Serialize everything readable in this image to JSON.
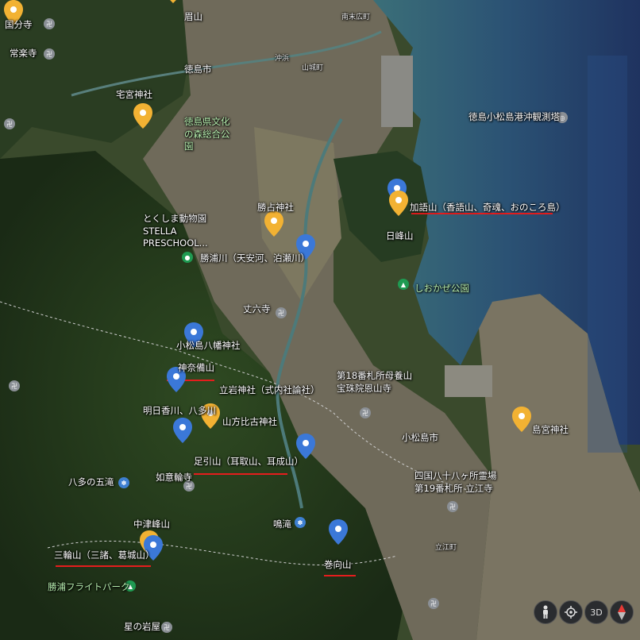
{
  "map_type": "satellite map view",
  "colors": {
    "pin_yellow": "#f2b233",
    "pin_blue": "#3b78d8",
    "underline_red": "#e51d1d",
    "sea": "#2f4f6a",
    "deep_sea": "#22375a"
  },
  "labels": {
    "l01": "眉山",
    "l02": "徳島市",
    "l03": "宅宮神社",
    "l04": "徳島県文化の森総合公園",
    "l05": "勝占神社",
    "l06": "とくしま動物園 STELLA PRESCHOOL...",
    "l07": "勝浦川（天安河、泊瀬川）",
    "l08": "加語山（香語山、奇魂、おのころ島）",
    "l09": "日峰山",
    "l10": "しおかぜ公園",
    "l11": "徳島小松島港沖観測塔",
    "l12": "丈六寺",
    "l13": "小松島八幡神社",
    "l14": "神奈備山",
    "l15": "立岩神社（式内社論社）",
    "l16": "明日香川、八多川",
    "l17": "山方比古神社",
    "l18": "足引山（耳取山、耳成山）",
    "l19": "如意輪寺",
    "l20": "八多の五滝",
    "l21": "中津峰山",
    "l22": "鳴滝",
    "l23": "三輪山（三諸、葛城山）",
    "l24": "巻向山",
    "l25": "勝浦フライトパーク",
    "l26": "星の岩屋",
    "l27": "第18番札所母養山宝珠院恩山寺",
    "l28": "小松島市",
    "l29": "四国八十八ヶ所霊場第19番札所 立江寺",
    "l30": "立江町",
    "l31": "島宮神社",
    "l32": "常楽寺",
    "l33": "国分寺",
    "l34": "沖浜",
    "l35": "山城町",
    "l36": "南末広町"
  },
  "controls": {
    "streetview": "pegman-icon",
    "locate": "crosshair-icon",
    "threed": "3D",
    "compass": "compass-icon"
  }
}
